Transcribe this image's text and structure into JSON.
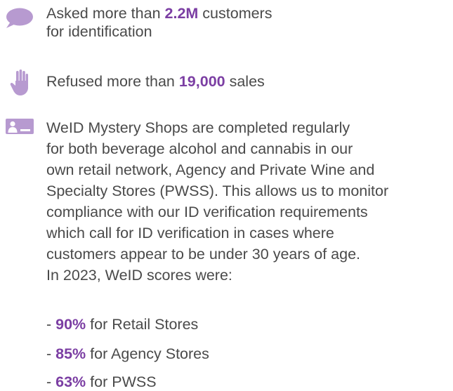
{
  "colors": {
    "accent": "#7b3ea3",
    "icon_fill": "#b79ad0",
    "text": "#4a4a4a"
  },
  "items": [
    {
      "icon": "speech-bubble-icon",
      "prefix": "Asked more than ",
      "highlight": "2.2M",
      "suffix": " customers",
      "line2": "for identification"
    },
    {
      "icon": "raised-hand-icon",
      "prefix": "Refused more than ",
      "highlight": "19,000",
      "suffix": " sales"
    },
    {
      "icon": "id-card-icon",
      "lines": [
        "WeID Mystery Shops are completed regularly",
        "for both beverage alcohol and cannabis in our",
        "own retail network, Agency and Private Wine and",
        "Specialty Stores (PWSS). This allows us to monitor",
        "compliance with our ID verification requirements",
        "which call for ID verification in cases where",
        "customers appear to be under 30 years of age.",
        "In 2023, WeID scores were:"
      ]
    }
  ],
  "scores": [
    {
      "dash": "- ",
      "value": "90%",
      "label": " for Retail Stores"
    },
    {
      "dash": "- ",
      "value": "85%",
      "label": " for Agency Stores"
    },
    {
      "dash": "- ",
      "value": "63%",
      "label": " for PWSS"
    }
  ]
}
